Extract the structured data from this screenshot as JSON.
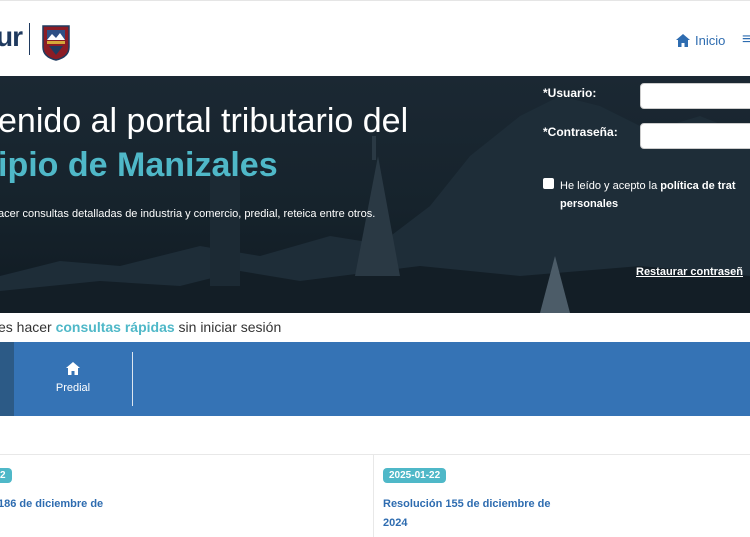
{
  "header": {
    "logo_text": "ur",
    "nav_home_label": "Inicio",
    "menu_icon": "≡"
  },
  "hero": {
    "title": "enido al portal tributario del",
    "subtitle": "ipio de Manizales",
    "description": "acer consultas detalladas de industria y comercio, predial, reteica entre otros."
  },
  "login": {
    "user_label": "*Usuario:",
    "user_value": "",
    "password_label": "*Contraseña:",
    "password_value": "",
    "terms_prefix": "He leído y acepto la ",
    "terms_bold": "política de trat",
    "terms_bold2": "personales",
    "restore_link": "Restaurar contraseñ"
  },
  "quick": {
    "prefix": "es hacer ",
    "highlight": "consultas rápidas",
    "suffix": " sin iniciar sesión"
  },
  "tabs": [
    {
      "label": "Predial",
      "icon": "home-icon"
    }
  ],
  "news": [
    {
      "date": "2",
      "title": "186 de diciembre de"
    },
    {
      "date": "2025-01-22",
      "title": "Resolución 155 de diciembre de 2024"
    }
  ],
  "colors": {
    "brand_blue": "#2e6cb0",
    "accent_teal": "#4fb8c8",
    "tab_bar": "#3573b5",
    "hero_dark": "#16232c"
  }
}
